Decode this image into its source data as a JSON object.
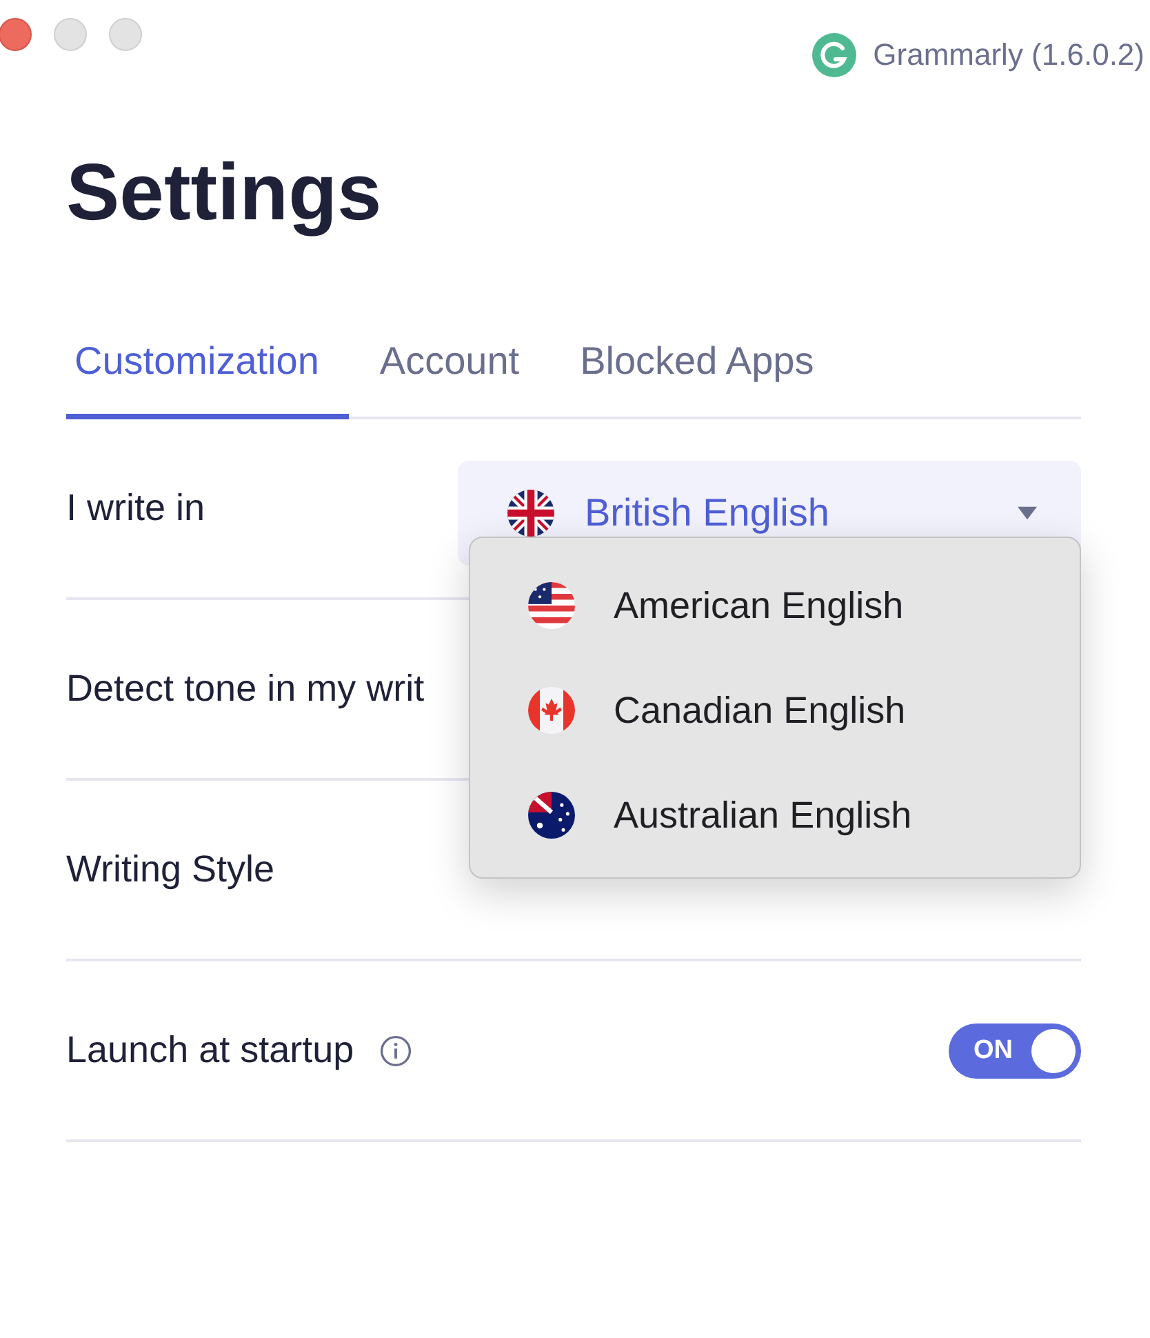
{
  "window": {
    "title": "Grammarly (1.6.0.2)"
  },
  "heading": "Settings",
  "tabs": [
    {
      "label": "Customization",
      "selected": true
    },
    {
      "label": "Account",
      "selected": false
    },
    {
      "label": "Blocked Apps",
      "selected": false
    }
  ],
  "rows": [
    {
      "kind": "select",
      "label": "I write in",
      "value": {
        "label": "British English",
        "kind": "gb"
      },
      "expanded": true,
      "options": [
        {
          "label": "American English",
          "kind": "us"
        },
        {
          "label": "Canadian English",
          "kind": "ca"
        },
        {
          "label": "Australian English",
          "kind": "au"
        }
      ]
    },
    {
      "kind": "plain",
      "label": "Detect tone in my writ"
    },
    {
      "kind": "plain",
      "label": "Writing Style"
    },
    {
      "kind": "toggle",
      "label": "Launch at startup",
      "info": true,
      "on": true,
      "toggle_text": "ON"
    }
  ]
}
